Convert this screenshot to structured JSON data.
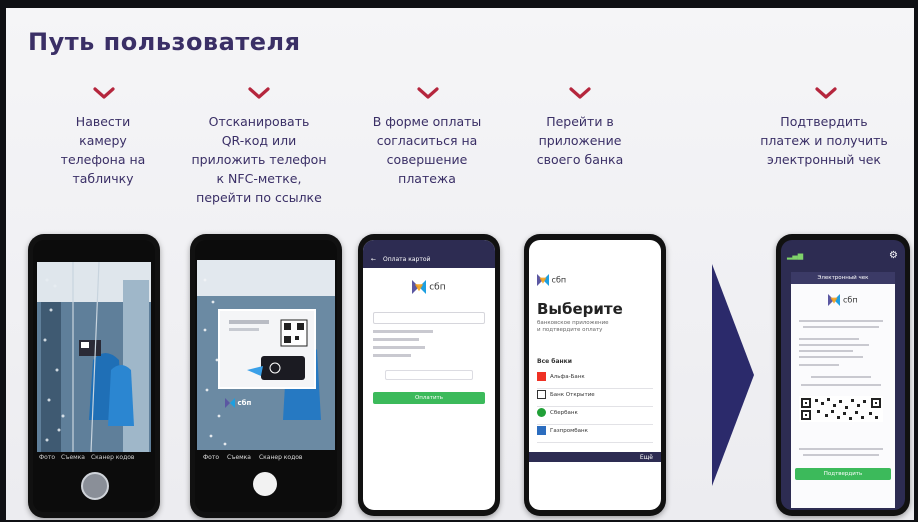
{
  "slide": {
    "title": "Путь пользователя",
    "accent_color": "#b5263d",
    "text_color": "#3a2f66",
    "steps": [
      {
        "id": 1,
        "text": "Навести\nкамеру\nтелефона на\nтабличку"
      },
      {
        "id": 2,
        "text": "Отсканировать\nQR-код или\nприложить телефон\nк NFC-метке,\nперейти по ссылке"
      },
      {
        "id": 3,
        "text": "В форме оплаты\nсогласиться на\nсовершение\nплатежа"
      },
      {
        "id": 4,
        "text": "Перейти в\nприложение\nсвоего банка"
      },
      {
        "id": 5,
        "text": "Подтвердить\nплатеж и получить\nэлектронный чек"
      }
    ]
  },
  "phones": {
    "brand": "сбп",
    "p2": {
      "modes": [
        "Фото",
        "Съемка",
        "Сканер кодов"
      ],
      "logo": "сбп"
    },
    "p3": {
      "header": "Оплата картой",
      "button": "Оплатить"
    },
    "p4": {
      "heading": "Выберите",
      "subheading": "банковское приложение\nи подтвердите оплату",
      "section": "Все банки",
      "banks": [
        "Альфа-Банк",
        "Банк Открытие",
        "Сбербанк",
        "Газпромбанк"
      ],
      "more": "Ещё"
    },
    "p5": {
      "header": "Электронный чек",
      "button": "Подтвердить"
    }
  }
}
